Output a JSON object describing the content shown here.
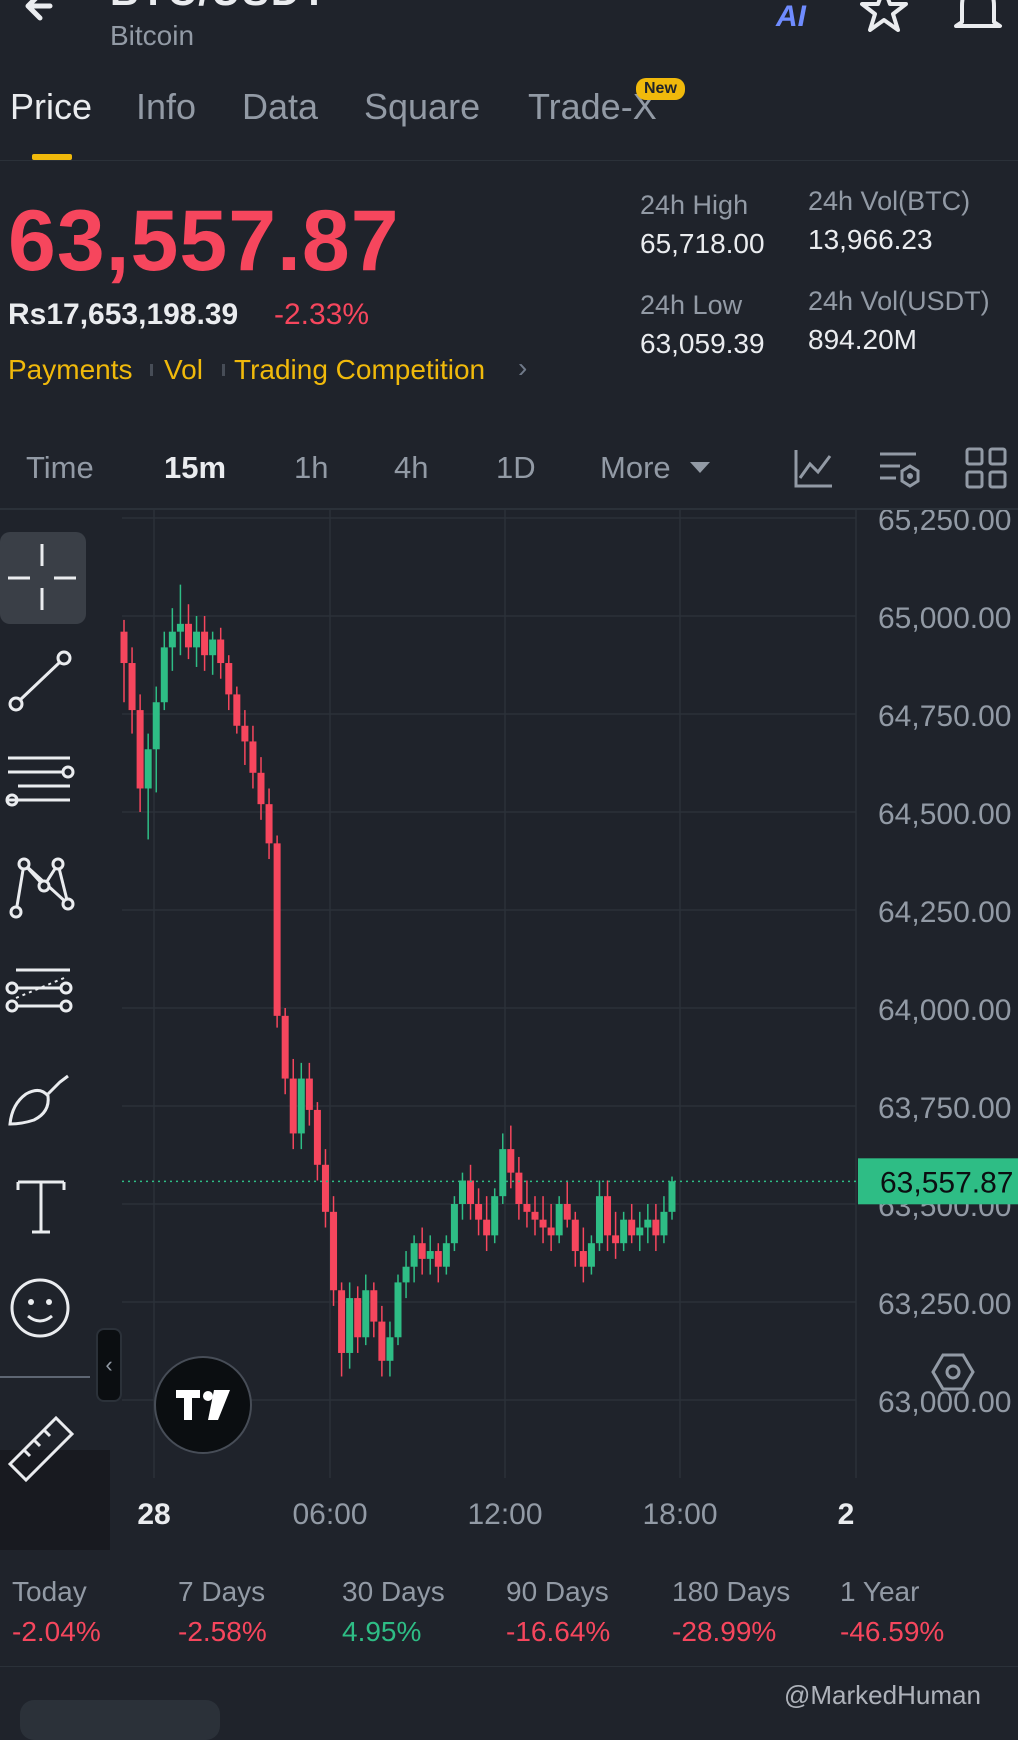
{
  "header": {
    "title": "BTC/USDT",
    "subtitle": "Bitcoin",
    "ai_label": "AI"
  },
  "tabs": [
    {
      "label": "Price",
      "active": true
    },
    {
      "label": "Info"
    },
    {
      "label": "Data"
    },
    {
      "label": "Square"
    },
    {
      "label": "Trade-X",
      "badge": "New"
    }
  ],
  "price": {
    "last": "63,557.87",
    "fiat": "Rs17,653,198.39",
    "change": "-2.33%"
  },
  "links": [
    "Payments",
    "Vol",
    "Trading Competition"
  ],
  "stats": {
    "high_label": "24h High",
    "high": "65,718.00",
    "vol_btc_label": "24h Vol(BTC)",
    "vol_btc": "13,966.23",
    "low_label": "24h Low",
    "low": "63,059.39",
    "vol_usdt_label": "24h Vol(USDT)",
    "vol_usdt": "894.20M"
  },
  "timeframes": [
    "Time",
    "15m",
    "1h",
    "4h",
    "1D",
    "More"
  ],
  "active_timeframe": "15m",
  "icons": {
    "back": "arrow-left-icon",
    "star": "star-icon",
    "bell": "bell-icon",
    "indicators": "line-chart-icon",
    "settings": "chart-settings-icon",
    "layout": "grid-icon",
    "time_settings": "hexagon-gear-icon"
  },
  "colors": {
    "up": "#2ebd85",
    "down": "#f6465d",
    "accent": "#f0b90b",
    "background": "#1f232b"
  },
  "chart_data": {
    "type": "candlestick",
    "price_axis": [
      "65,250.00",
      "65,000.00",
      "64,750.00",
      "64,500.00",
      "64,250.00",
      "64,000.00",
      "63,750.00",
      "63,500.00",
      "63,250.00",
      "63,000.00"
    ],
    "ylim": [
      62900,
      65300
    ],
    "time_axis": [
      "28",
      "06:00",
      "12:00",
      "18:00",
      "2"
    ],
    "last_price_label": "63,557.87",
    "last_price": 63557.87,
    "candles": [
      [
        64960,
        64990,
        64780,
        64880
      ],
      [
        64880,
        64920,
        64700,
        64760
      ],
      [
        64760,
        64800,
        64500,
        64560
      ],
      [
        64560,
        64700,
        64430,
        64660
      ],
      [
        64660,
        64820,
        64550,
        64780
      ],
      [
        64780,
        64960,
        64760,
        64920
      ],
      [
        64920,
        65020,
        64860,
        64960
      ],
      [
        64960,
        65080,
        64900,
        64980
      ],
      [
        64980,
        65030,
        64890,
        64920
      ],
      [
        64920,
        65000,
        64870,
        64960
      ],
      [
        64960,
        65000,
        64860,
        64900
      ],
      [
        64900,
        64960,
        64850,
        64940
      ],
      [
        64940,
        64970,
        64840,
        64880
      ],
      [
        64880,
        64900,
        64760,
        64800
      ],
      [
        64800,
        64820,
        64700,
        64720
      ],
      [
        64720,
        64760,
        64620,
        64680
      ],
      [
        64680,
        64720,
        64560,
        64600
      ],
      [
        64600,
        64640,
        64480,
        64520
      ],
      [
        64520,
        64560,
        64380,
        64420
      ],
      [
        64420,
        64440,
        63950,
        63980
      ],
      [
        63980,
        64000,
        63780,
        63820
      ],
      [
        63820,
        63870,
        63640,
        63680
      ],
      [
        63680,
        63860,
        63640,
        63820
      ],
      [
        63820,
        63860,
        63700,
        63740
      ],
      [
        63740,
        63760,
        63560,
        63600
      ],
      [
        63600,
        63640,
        63440,
        63480
      ],
      [
        63480,
        63520,
        63240,
        63280
      ],
      [
        63280,
        63300,
        63060,
        63120
      ],
      [
        63120,
        63300,
        63080,
        63260
      ],
      [
        63260,
        63290,
        63120,
        63160
      ],
      [
        63160,
        63320,
        63140,
        63280
      ],
      [
        63280,
        63300,
        63160,
        63200
      ],
      [
        63200,
        63240,
        63060,
        63100
      ],
      [
        63100,
        63200,
        63060,
        63160
      ],
      [
        63160,
        63320,
        63140,
        63300
      ],
      [
        63300,
        63380,
        63260,
        63340
      ],
      [
        63340,
        63420,
        63300,
        63400
      ],
      [
        63400,
        63440,
        63320,
        63360
      ],
      [
        63360,
        63420,
        63320,
        63380
      ],
      [
        63380,
        63400,
        63300,
        63340
      ],
      [
        63340,
        63420,
        63320,
        63400
      ],
      [
        63400,
        63520,
        63380,
        63500
      ],
      [
        63500,
        63580,
        63460,
        63560
      ],
      [
        63560,
        63600,
        63460,
        63500
      ],
      [
        63500,
        63540,
        63420,
        63460
      ],
      [
        63460,
        63520,
        63380,
        63420
      ],
      [
        63420,
        63540,
        63400,
        63520
      ],
      [
        63520,
        63680,
        63500,
        63640
      ],
      [
        63640,
        63700,
        63540,
        63580
      ],
      [
        63580,
        63620,
        63460,
        63500
      ],
      [
        63500,
        63560,
        63440,
        63480
      ],
      [
        63480,
        63520,
        63420,
        63460
      ],
      [
        63460,
        63520,
        63400,
        63440
      ],
      [
        63440,
        63500,
        63380,
        63420
      ],
      [
        63420,
        63520,
        63400,
        63500
      ],
      [
        63500,
        63560,
        63440,
        63460
      ],
      [
        63460,
        63480,
        63340,
        63380
      ],
      [
        63380,
        63440,
        63300,
        63340
      ],
      [
        63340,
        63420,
        63320,
        63400
      ],
      [
        63400,
        63560,
        63380,
        63520
      ],
      [
        63520,
        63560,
        63380,
        63420
      ],
      [
        63420,
        63480,
        63360,
        63400
      ],
      [
        63400,
        63480,
        63380,
        63460
      ],
      [
        63460,
        63500,
        63400,
        63420
      ],
      [
        63420,
        63480,
        63380,
        63440
      ],
      [
        63440,
        63500,
        63400,
        63460
      ],
      [
        63460,
        63500,
        63380,
        63420
      ],
      [
        63420,
        63520,
        63400,
        63480
      ],
      [
        63480,
        63570,
        63460,
        63558
      ]
    ]
  },
  "performance": [
    {
      "label": "Today",
      "value": "-2.04%",
      "sign": "neg"
    },
    {
      "label": "7 Days",
      "value": "-2.58%",
      "sign": "neg"
    },
    {
      "label": "30 Days",
      "value": "4.95%",
      "sign": "pos"
    },
    {
      "label": "90 Days",
      "value": "-16.64%",
      "sign": "neg"
    },
    {
      "label": "180 Days",
      "value": "-28.99%",
      "sign": "neg"
    },
    {
      "label": "1 Year",
      "value": "-46.59%",
      "sign": "neg"
    }
  ],
  "watermark": "@MarkedHuman"
}
